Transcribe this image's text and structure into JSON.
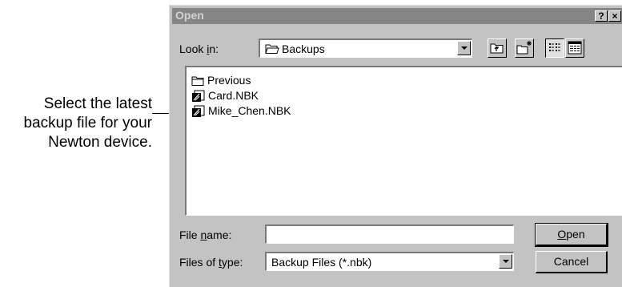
{
  "callout": {
    "line1": "Select the latest",
    "line2": "backup file for your",
    "line3": "Newton device."
  },
  "dialog": {
    "title": "Open",
    "help_label": "?",
    "close_label": "×",
    "look_in": {
      "label_pre": "Look ",
      "label_key": "i",
      "label_post": "n:",
      "value": "Backups",
      "value_icon": "open-folder-icon"
    },
    "toolbar": {
      "up_one_level": "up-folder-icon",
      "new_folder": "new-folder-icon",
      "list_view": "list-view-icon",
      "details_view": "details-view-icon"
    },
    "files": [
      {
        "name": "Previous",
        "icon": "folder-icon"
      },
      {
        "name": "Card.NBK",
        "icon": "newton-backup-icon"
      },
      {
        "name": "Mike_Chen.NBK",
        "icon": "newton-backup-icon"
      }
    ],
    "file_name": {
      "label_pre": "File ",
      "label_key": "n",
      "label_post": "ame:",
      "value": ""
    },
    "file_type": {
      "label_pre": "Files of ",
      "label_key": "t",
      "label_post": "ype:",
      "value": "Backup Files (*.nbk)"
    },
    "open_button": {
      "key": "O",
      "rest": "pen"
    },
    "cancel_button": "Cancel"
  }
}
